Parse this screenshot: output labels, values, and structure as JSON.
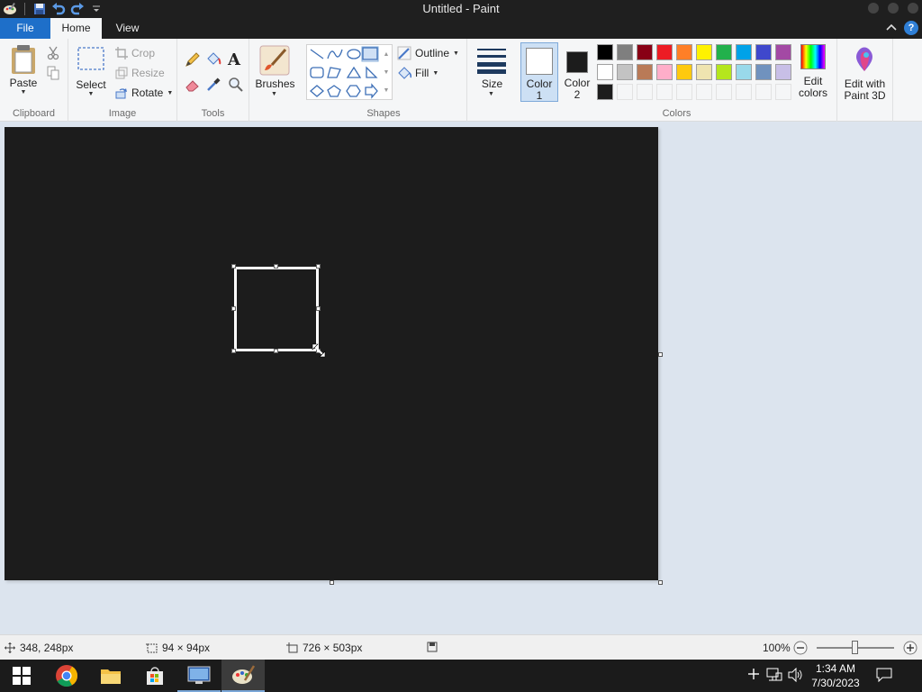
{
  "window": {
    "title": "Untitled - Paint"
  },
  "tabs": {
    "file": "File",
    "home": "Home",
    "view": "View"
  },
  "ribbon": {
    "clipboard": {
      "paste": "Paste",
      "label": "Clipboard"
    },
    "image": {
      "select": "Select",
      "crop": "Crop",
      "resize": "Resize",
      "rotate": "Rotate",
      "label": "Image"
    },
    "tools": {
      "label": "Tools"
    },
    "brushes": {
      "label": "Brushes"
    },
    "shapes": {
      "outline": "Outline",
      "fill": "Fill",
      "label": "Shapes"
    },
    "size": {
      "label": "Size"
    },
    "colors": {
      "color1": "Color\n1",
      "color1_line1": "Color",
      "color1_line2": "1",
      "color2_line1": "Color",
      "color2_line2": "2",
      "edit_colors_line1": "Edit",
      "edit_colors_line2": "colors",
      "label": "Colors",
      "color1_value": "#ffffff",
      "color2_value": "#1c1c1c",
      "palette_row1": [
        "#000000",
        "#7f7f7f",
        "#880015",
        "#ed1c24",
        "#ff7f27",
        "#fff200",
        "#22b14c",
        "#00a2e8",
        "#3f48cc",
        "#a349a4"
      ],
      "palette_row2": [
        "#ffffff",
        "#c3c3c3",
        "#b97a57",
        "#ffaec9",
        "#ffc90e",
        "#efe4b0",
        "#b5e61d",
        "#99d9ea",
        "#7092be",
        "#c8bfe7"
      ],
      "palette_row3": [
        "#1c1c1c"
      ]
    },
    "paint3d": {
      "line1": "Edit with",
      "line2": "Paint 3D"
    }
  },
  "status": {
    "cursor_pos": "348, 248px",
    "selection_size": "94 × 94px",
    "canvas_size": "726 × 503px",
    "zoom": "100%"
  },
  "taskbar": {
    "time": "1:34 AM",
    "date": "7/30/2023"
  }
}
